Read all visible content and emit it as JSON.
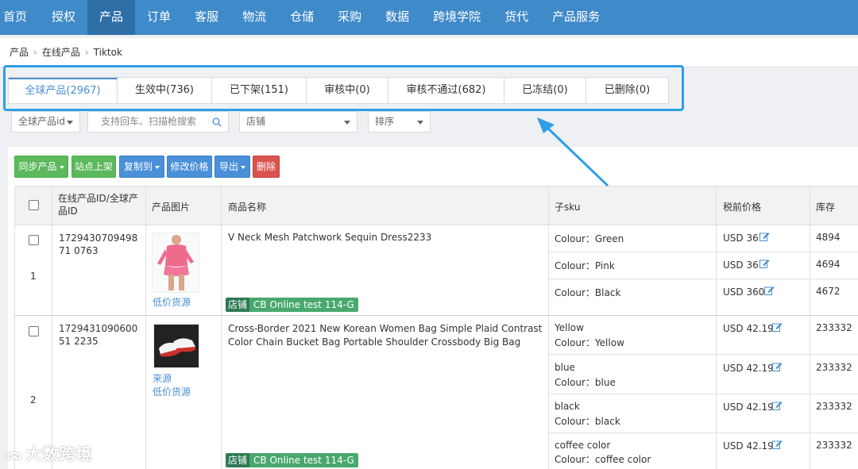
{
  "nav": [
    "首页",
    "授权",
    "产品",
    "订单",
    "客服",
    "物流",
    "仓储",
    "采购",
    "数据",
    "跨境学院",
    "货代",
    "产品服务"
  ],
  "nav_active": 2,
  "breadcrumb": [
    "产品",
    "在线产品",
    "Tiktok"
  ],
  "tabs": [
    "全球产品(2967)",
    "生效中(736)",
    "已下架(151)",
    "审核中(0)",
    "审核不通过(682)",
    "已冻结(0)",
    "已删除(0)"
  ],
  "tab_active": 0,
  "filters": {
    "id_select": "全球产品id",
    "search_placeholder": "支持回车、扫描枪搜索",
    "shop_select": "店铺",
    "sort_select": "排序"
  },
  "buttons": {
    "sync": "同步产品",
    "site_list": "站点上架",
    "copy": "复制到",
    "edit_price": "修改价格",
    "export": "导出",
    "delete": "删除"
  },
  "columns": {
    "id": "在线产品ID/全球产品ID",
    "image": "产品图片",
    "name": "商品名称",
    "sku": "子sku",
    "price": "税前价格",
    "stock": "库存"
  },
  "rows": [
    {
      "index": "1",
      "id": "172943070949871 0763",
      "name": "V Neck Mesh Patchwork Sequin Dress2233",
      "links": [
        "低价货源"
      ],
      "shop_key": "店铺",
      "shop_value": "CB Online test 114-G",
      "skus": [
        {
          "title": "",
          "attr": "Colour：Green",
          "price": "USD 36",
          "stock": "4894"
        },
        {
          "title": "",
          "attr": "Colour：Pink",
          "price": "USD 36",
          "stock": "4694"
        },
        {
          "title": "",
          "attr": "Colour：Black",
          "price": "USD 360",
          "stock": "4672"
        }
      ]
    },
    {
      "index": "2",
      "id": "172943109060051 2235",
      "name": "Cross-Border 2021 New Korean Women Bag Simple Plaid Contrast Color Chain Bucket Bag Portable Shoulder Crossbody Big Bag",
      "links": [
        "来源",
        "低价货源"
      ],
      "shop_key": "店铺",
      "shop_value": "CB Online test 114-G",
      "skus": [
        {
          "title": "Yellow",
          "attr": "Colour：Yellow",
          "price": "USD 42.19",
          "stock": "233332"
        },
        {
          "title": "blue",
          "attr": "Colour：blue",
          "price": "USD 42.19",
          "stock": "233332"
        },
        {
          "title": "black",
          "attr": "Colour：black",
          "price": "USD 42.19",
          "stock": "233332"
        },
        {
          "title": "coffee color",
          "attr": "Colour：coffee color",
          "price": "USD 42.19",
          "stock": "233332"
        }
      ]
    }
  ],
  "watermark": "大数跨境",
  "colors": {
    "nav_bg": "#3f8ac9",
    "highlight": "#2f9ee8",
    "tab_active": "#4d8ed1",
    "green": "#5cb85c",
    "shop_badge": "#48a86d"
  }
}
